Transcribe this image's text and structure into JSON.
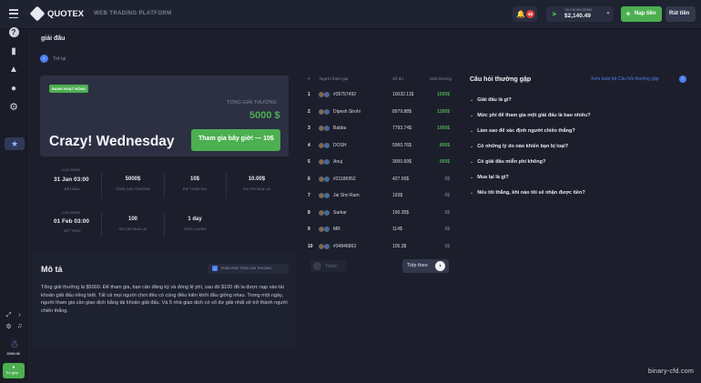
{
  "header": {
    "brand": "QUOTEX",
    "platform": "WEB TRADING PLATFORM",
    "notif_count": "48",
    "account_type": "TÀI KHOẢN DEMO",
    "balance": "$2,140.49",
    "deposit_label": "Nạp tiền",
    "withdraw_label": "Rút tiền"
  },
  "sidebar": {
    "user_label": "JOHN 08",
    "help_label": "Trợ giúp",
    "items": [
      "help-icon",
      "chart-icon",
      "education-icon",
      "profile-icon",
      "settings-icon",
      "tournament-icon"
    ]
  },
  "page": {
    "title": "giải đấu",
    "back_label": "Trở lại"
  },
  "tournament": {
    "status": "ĐANG HOẠT ĐỘNG",
    "prize_label": "TỔNG GIẢI THƯỞNG",
    "prize_value": "5000 $",
    "name": "Crazy! Wednesday",
    "join_label": "Tham gia bây giờ! — 10$",
    "start_label": "LỰA CHỌN",
    "start_date": "31 Jan 03:00",
    "start_sub": "BẮT ĐẦU",
    "end_label": "LỰA CHỌN",
    "end_date": "01 Feb 03:00",
    "end_sub": "KẾT THÚC",
    "stats": [
      {
        "value": "5000$",
        "label": "TỔNG GIẢI THƯỞNG"
      },
      {
        "value": "10$",
        "label": "PHÍ THAM GIA"
      },
      {
        "value": "10.00$",
        "label": "CHI PHÍ MUA LẠI"
      },
      {
        "value": "100",
        "label": "SỐ LẦN MUA LẠI"
      },
      {
        "value": "1 day",
        "label": "THỜI LƯỢNG"
      }
    ]
  },
  "description": {
    "title": "Mô tả",
    "badge": "PHÂN PHỐI TỔNG GIẢI THƯỞNG",
    "text": "Tổng giải thưởng là $5000. Để tham gia, bạn cần đăng ký và đóng lệ phí, sau đó $100 đô la được nạp vào tài khoản giải đấu riêng biệt. Tất cả mọi người chơi đều có cùng điều kiện khởi đầu giống nhau. Trong một ngày, người tham gia cần giao dịch bằng tài khoản giải đấu. Và 5 nhà giao dịch có số dư giải nhất sẽ trở thành người chiến thắng."
  },
  "leaderboard": {
    "headers": [
      "#",
      "Người tham gia",
      "Số dư",
      "Giải thưởng"
    ],
    "rows": [
      {
        "rank": "1",
        "name": "#35757492",
        "balance": "10032.11$",
        "prize": "1500$"
      },
      {
        "rank": "2",
        "name": "Dipesh Sirohi",
        "balance": "8979.88$",
        "prize": "1200$"
      },
      {
        "rank": "3",
        "name": "Babbu",
        "balance": "7793.74$",
        "prize": "1000$"
      },
      {
        "rank": "4",
        "name": "DOSH",
        "balance": "5960.76$",
        "prize": "800$"
      },
      {
        "rank": "5",
        "name": "Anuj",
        "balance": "3000.69$",
        "prize": "500$"
      },
      {
        "rank": "6",
        "name": "#21186952",
        "balance": "427.56$",
        "prize": "0$"
      },
      {
        "rank": "7",
        "name": "Jai Shri Ram",
        "balance": "193$",
        "prize": "0$"
      },
      {
        "rank": "8",
        "name": "Sarkar",
        "balance": "190.35$",
        "prize": "0$"
      },
      {
        "rank": "9",
        "name": "MR",
        "balance": "114$",
        "prize": "0$"
      },
      {
        "rank": "10",
        "name": "#34846863",
        "balance": "105.3$",
        "prize": "0$"
      }
    ],
    "prev_label": "Trước",
    "next_label": "Tiếp theo"
  },
  "faq": {
    "title": "Câu hỏi thường gặp",
    "link": "Xem toàn bộ Câu hỏi thường gặp",
    "items": [
      "Giải đấu là gì?",
      "Mức phí để tham gia một giải đấu là bao nhiêu?",
      "Làm sao để xác định người chiến thắng?",
      "Có những lý do nào khiến bạn bị loại?",
      "Có giải đấu miễn phí không?",
      "Mua lại là gì?",
      "Nếu tôi thắng, khi nào tôi sẽ nhận được tiền?"
    ]
  },
  "watermark": "binary-cfd.com",
  "colors": {
    "accent": "#4caf50",
    "link": "#4f7ff0",
    "background": "#1c1f2b"
  }
}
